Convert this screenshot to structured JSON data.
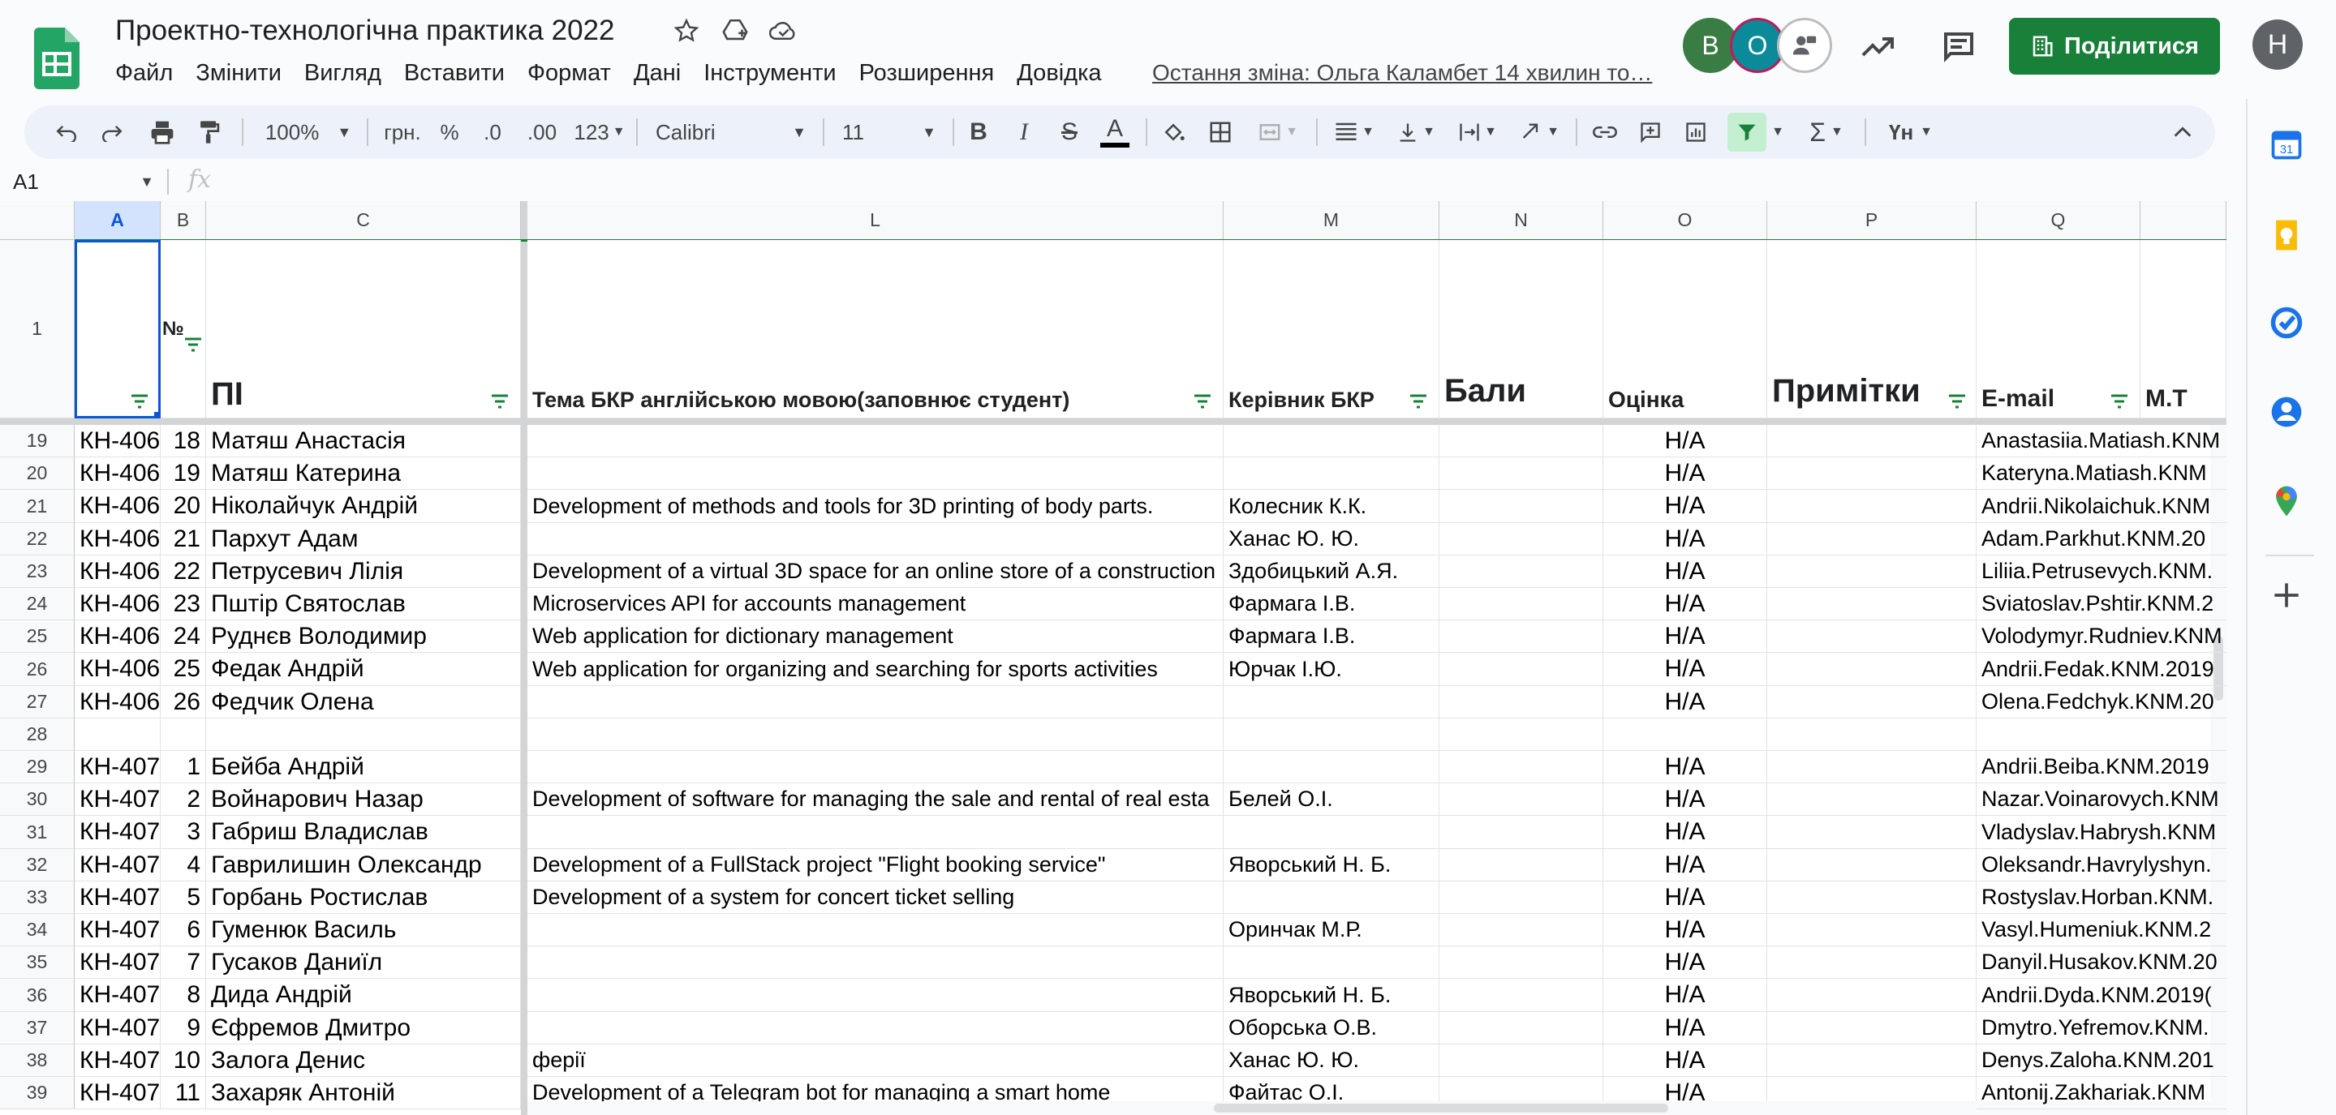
{
  "app": {
    "title": "Проектно-технологічна практика 2022",
    "last_edit": "Остання зміна: Ольга Каламбет 14 хвилин то…",
    "share_label": "Поділитися",
    "user_initial": "Н",
    "collaborators": [
      {
        "initial": "В",
        "color": "#3a7d44"
      },
      {
        "initial": "О",
        "color": "#0b8a9a"
      }
    ],
    "title_icons": [
      "star-icon",
      "drive-move-icon",
      "cloud-saved-icon"
    ],
    "header_icons": [
      "activity-trend-icon",
      "comments-icon"
    ]
  },
  "menu": [
    "Файл",
    "Змінити",
    "Вигляд",
    "Вставити",
    "Формат",
    "Дані",
    "Інструменти",
    "Розширення",
    "Довідка"
  ],
  "toolbar": {
    "zoom": "100%",
    "currency": "грн.",
    "percent": "%",
    "dec_decrease": ".0",
    "dec_increase": ".00",
    "number_format": "123",
    "font": "Calibri",
    "font_size": "11",
    "bold": "B",
    "italic": "I",
    "strike": "S",
    "text_color": "A",
    "functions": "Σ",
    "input_tools": "Үн"
  },
  "formula_bar": {
    "cell_ref": "A1",
    "fx": "fx",
    "value": ""
  },
  "columns": [
    "A",
    "B",
    "C",
    "L",
    "M",
    "N",
    "O",
    "P",
    "Q"
  ],
  "header_row": {
    "row_num": "1",
    "A": "",
    "B": "№",
    "C": "ПІ",
    "L": "Тема БКР англійською мовою(заповнює студент)",
    "M": "Керівник БКР",
    "N": "Бали",
    "O": "Оцінка",
    "P": "Примітки",
    "Q": "E-mail",
    "R": "М.Т"
  },
  "rows": [
    {
      "n": "19",
      "A": "КН-406",
      "B": "18",
      "C": "Матяш Анастасія",
      "L": "",
      "M": "",
      "O": "Н/А",
      "Q": "Anastasiia.Matiash.KNM"
    },
    {
      "n": "20",
      "A": "КН-406",
      "B": "19",
      "C": "Матяш Катерина",
      "L": "",
      "M": "",
      "O": "Н/А",
      "Q": "Kateryna.Matiash.KNM"
    },
    {
      "n": "21",
      "A": "КН-406",
      "B": "20",
      "C": "Ніколайчук Андрій",
      "L": "Development of methods and tools for 3D printing of body parts.",
      "M": "Колесник К.К.",
      "O": "Н/А",
      "Q": "Andrii.Nikolaichuk.KNM"
    },
    {
      "n": "22",
      "A": "КН-406",
      "B": "21",
      "C": "Пархут Адам",
      "L": "",
      "M": "Ханас Ю. Ю.",
      "O": "Н/А",
      "Q": "Adam.Parkhut.KNM.20"
    },
    {
      "n": "23",
      "A": "КН-406",
      "B": "22",
      "C": "Петрусевич Лілія",
      "L": "Development of a virtual 3D space for an online store of a construction",
      "M": "Здобицький А.Я.",
      "O": "Н/А",
      "Q": "Liliia.Petrusevych.KNM."
    },
    {
      "n": "24",
      "A": "КН-406",
      "B": "23",
      "C": "Пштір Святослав",
      "L": "Microservices API for accounts management",
      "M": "Фармага І.В.",
      "O": "Н/А",
      "Q": "Sviatoslav.Pshtir.KNM.2"
    },
    {
      "n": "25",
      "A": "КН-406",
      "B": "24",
      "C": "Руднєв Володимир",
      "L": "Web application for dictionary management",
      "M": "Фармага І.В.",
      "O": "Н/А",
      "Q": "Volodymyr.Rudniev.KNM"
    },
    {
      "n": "26",
      "A": "КН-406",
      "B": "25",
      "C": "Федак Андрій",
      "L": "Web application for organizing and searching for sports activities",
      "M": "Юрчак І.Ю.",
      "O": "Н/А",
      "Q": "Andrii.Fedak.KNM.2019"
    },
    {
      "n": "27",
      "A": "КН-406",
      "B": "26",
      "C": "Федчик Олена",
      "L": "",
      "M": "",
      "O": "Н/А",
      "Q": "Olena.Fedchyk.KNM.20"
    },
    {
      "n": "28",
      "A": "",
      "B": "",
      "C": "",
      "L": "",
      "M": "",
      "O": "",
      "Q": ""
    },
    {
      "n": "29",
      "A": "КН-407",
      "B": "1",
      "C": "Бейба Андрій",
      "L": "",
      "M": "",
      "O": "Н/А",
      "Q": "Andrii.Beiba.KNM.2019"
    },
    {
      "n": "30",
      "A": "КН-407",
      "B": "2",
      "C": "Войнарович Назар",
      "L": "Development of software for managing the sale and rental of real esta",
      "M": "Белей О.І.",
      "O": "Н/А",
      "Q": "Nazar.Voinarovych.KNM"
    },
    {
      "n": "31",
      "A": "КН-407",
      "B": "3",
      "C": "Габриш Владислав",
      "L": "",
      "M": "",
      "O": "Н/А",
      "Q": "Vladyslav.Habrysh.KNM"
    },
    {
      "n": "32",
      "A": "КН-407",
      "B": "4",
      "C": "Гаврилишин Олександр",
      "L": "Development of a FullStack project \"Flight booking service\"",
      "M": "Яворський Н. Б.",
      "O": "Н/А",
      "Q": "Oleksandr.Havrylyshyn."
    },
    {
      "n": "33",
      "A": "КН-407",
      "B": "5",
      "C": "Горбань Ростислав",
      "L": "Development of a system for concert ticket selling",
      "M": "",
      "O": "Н/А",
      "Q": "Rostyslav.Horban.KNM."
    },
    {
      "n": "34",
      "A": "КН-407",
      "B": "6",
      "C": "Гуменюк Василь",
      "L": "",
      "M": "Оринчак М.Р.",
      "O": "Н/А",
      "Q": "Vasyl.Humeniuk.KNM.2"
    },
    {
      "n": "35",
      "A": "КН-407",
      "B": "7",
      "C": "Гусаков Даниїл",
      "L": "",
      "M": "",
      "O": "Н/А",
      "Q": "Danyil.Husakov.KNM.20"
    },
    {
      "n": "36",
      "A": "КН-407",
      "B": "8",
      "C": "Дида Андрій",
      "L": "",
      "M": "Яворський Н. Б.",
      "O": "Н/А",
      "Q": "Andrii.Dyda.KNM.2019("
    },
    {
      "n": "37",
      "A": "КН-407",
      "B": "9",
      "C": "Єфремов Дмитро",
      "L": "",
      "M": "Оборська О.В.",
      "O": "Н/А",
      "Q": "Dmytro.Yefremov.KNM."
    },
    {
      "n": "38",
      "A": "КН-407",
      "B": "10",
      "C": "Залога Денис",
      "L": "ферії",
      "M": "Ханас Ю. Ю.",
      "O": "Н/А",
      "Q": "Denys.Zaloha.KNM.201"
    },
    {
      "n": "39",
      "A": "КН-407",
      "B": "11",
      "C": "Захаряк Антоній",
      "L": "Development of a Telegram bot for managing a smart home",
      "M": "Файтас О.І.",
      "O": "Н/А",
      "Q": "Antonij.Zakhariak.KNM"
    }
  ]
}
